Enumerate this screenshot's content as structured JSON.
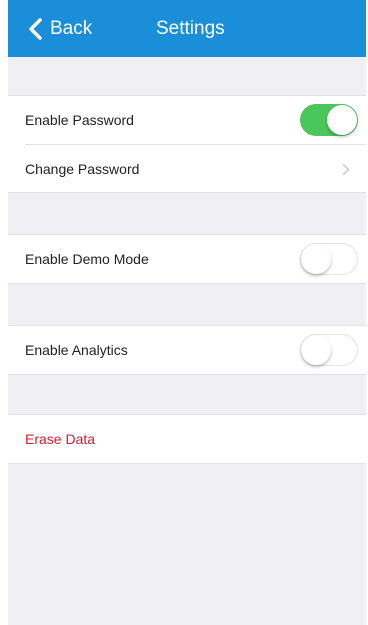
{
  "navbar": {
    "back_label": "Back",
    "title": "Settings",
    "color": "#1a8ed8"
  },
  "settings": {
    "enable_password": {
      "label": "Enable Password",
      "enabled": true
    },
    "change_password": {
      "label": "Change Password",
      "icon": "chevron-right-icon"
    },
    "enable_demo_mode": {
      "label": "Enable Demo Mode",
      "enabled": false
    },
    "enable_analytics": {
      "label": "Enable Analytics",
      "enabled": false
    },
    "erase_data": {
      "label": "Erase Data",
      "color": "#d22030"
    }
  },
  "colors": {
    "background": "#efeff4",
    "toggle_on": "#4bc65a"
  }
}
